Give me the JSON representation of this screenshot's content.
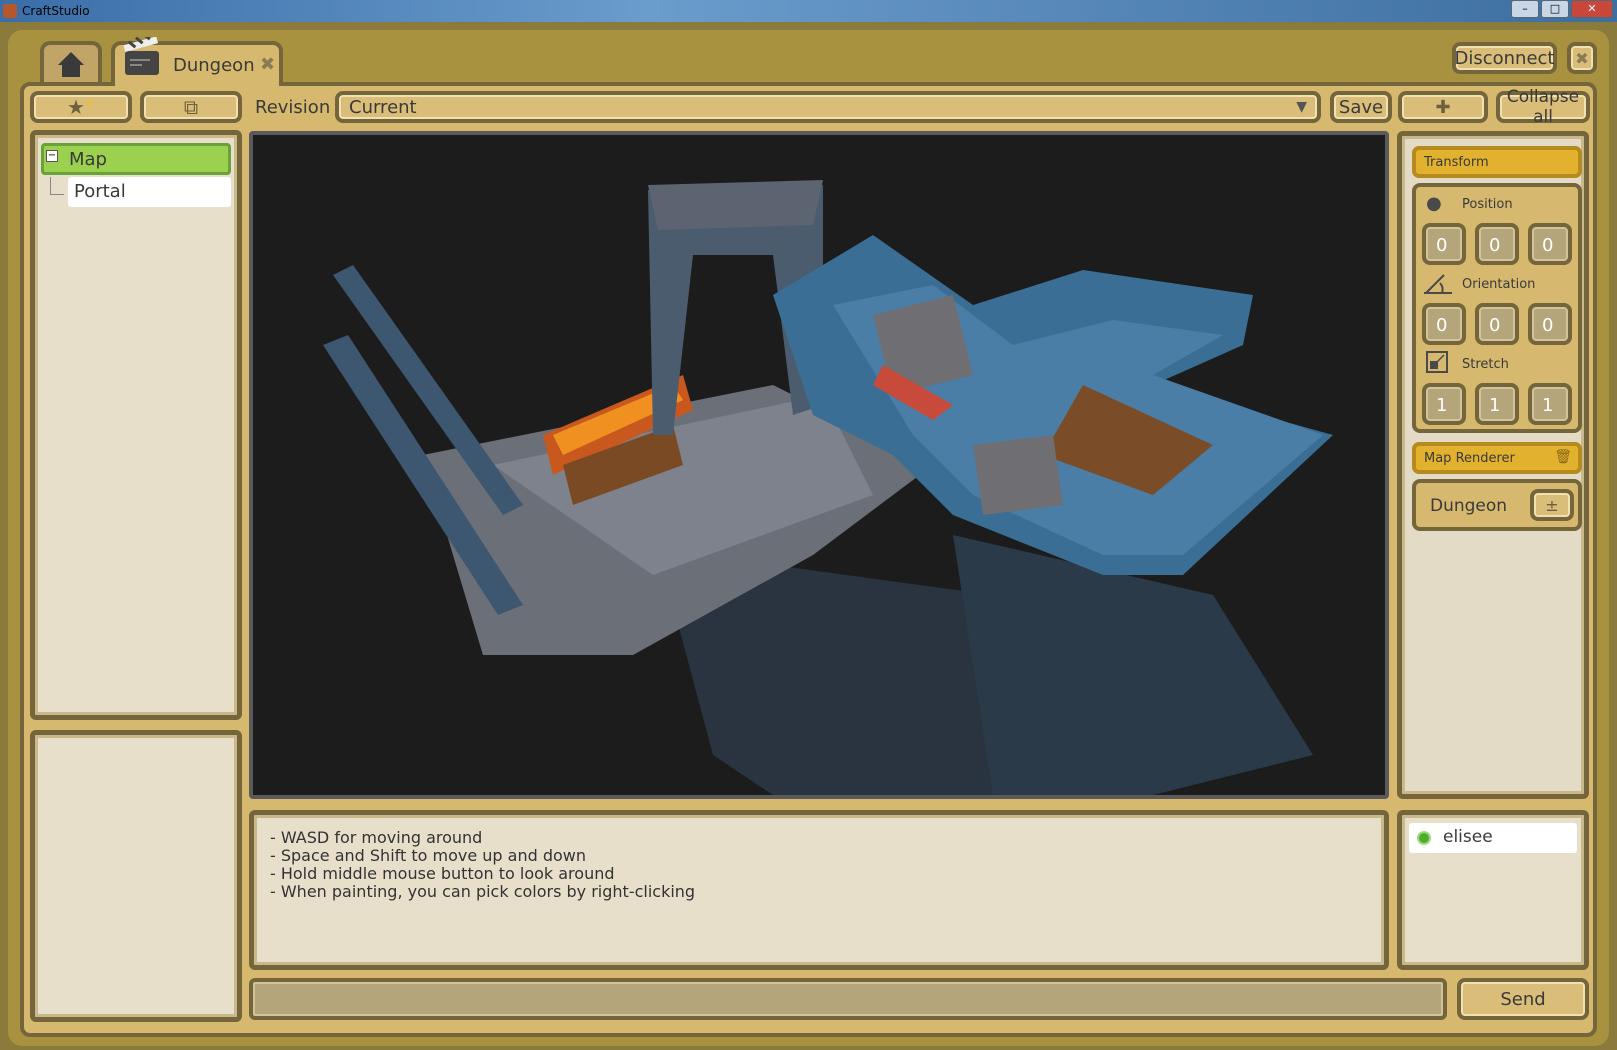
{
  "window": {
    "title": "CraftStudio"
  },
  "tabs": [
    {
      "label": "Dungeon",
      "icon": "clapperboard-icon"
    }
  ],
  "header": {
    "disconnect_label": "Disconnect"
  },
  "toolbar": {
    "revision_label": "Revision",
    "revision_value": "Current",
    "save_label": "Save",
    "collapse_all_label": "Collapse all"
  },
  "tree": {
    "items": [
      {
        "label": "Map",
        "selected": true
      },
      {
        "label": "Portal"
      }
    ]
  },
  "inspector": {
    "transform_label": "Transform",
    "position_label": "Position",
    "position": [
      "0",
      "0",
      "0"
    ],
    "orientation_label": "Orientation",
    "orientation": [
      "0",
      "0",
      "0"
    ],
    "stretch_label": "Stretch",
    "stretch": [
      "1",
      "1",
      "1"
    ],
    "map_renderer_label": "Map Renderer",
    "map_value": "Dungeon"
  },
  "chat": {
    "lines": [
      "- WASD for moving around",
      "- Space and Shift to move up and down",
      "- Hold middle mouse button to look around",
      "- When painting, you can pick colors by right-clicking"
    ],
    "input_value": "",
    "send_label": "Send"
  },
  "users": [
    {
      "name": "elisee",
      "status": "online",
      "status_color": "#4caf2a"
    }
  ],
  "colors": {
    "accent": "#e2b12d",
    "selected": "#9bd14e",
    "panel": "#d7b86f"
  }
}
